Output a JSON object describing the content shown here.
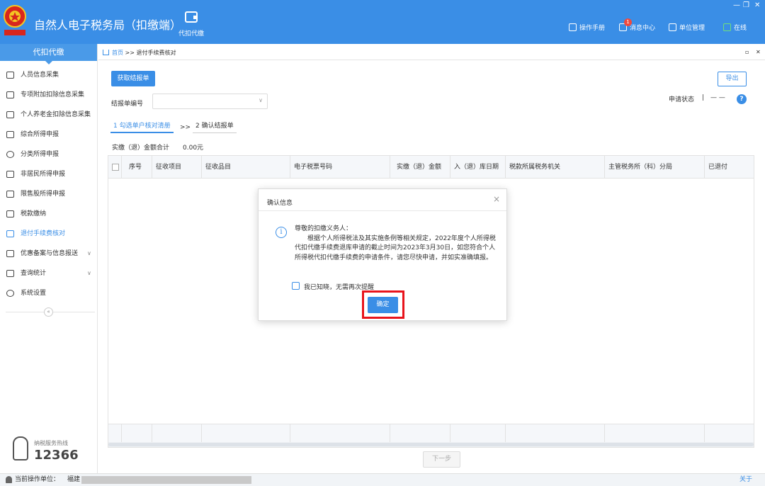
{
  "app": {
    "title": "自然人电子税务局（扣缴端）",
    "logo_text": "中国税务",
    "module_label": "代扣代缴",
    "header_links": [
      {
        "icon": "manual-icon",
        "label": "操作手册"
      },
      {
        "icon": "message-icon",
        "label": "消息中心",
        "badge": "1"
      },
      {
        "icon": "unit-icon",
        "label": "单位管理"
      },
      {
        "icon": "monitor-icon",
        "label": "在线"
      }
    ],
    "window_controls": {
      "minimize": "—",
      "restore": "❐",
      "close": "✕"
    }
  },
  "sidebar": {
    "header": "代扣代缴",
    "items": [
      {
        "label": "人员信息采集",
        "icon": "person-icon",
        "active": false
      },
      {
        "label": "专项附加扣除信息采集",
        "icon": "list-icon",
        "active": false
      },
      {
        "label": "个人养老金扣除信息采集",
        "icon": "pension-icon",
        "active": false
      },
      {
        "label": "综合所得申报",
        "icon": "layers-icon",
        "active": false
      },
      {
        "label": "分类所得申报",
        "icon": "pie-icon",
        "active": false
      },
      {
        "label": "非居民所得申报",
        "icon": "nonresident-icon",
        "active": false
      },
      {
        "label": "限售股所得申报",
        "icon": "bar-icon",
        "active": false
      },
      {
        "label": "税款缴纳",
        "icon": "folder-icon",
        "active": false
      },
      {
        "label": "退付手续费核对",
        "icon": "doc-icon",
        "active": true
      },
      {
        "label": "优惠备案与信息报送",
        "icon": "file-icon",
        "active": false,
        "expandable": true
      },
      {
        "label": "查询统计",
        "icon": "query-icon",
        "active": false,
        "expandable": true
      },
      {
        "label": "系统设置",
        "icon": "gear-icon",
        "active": false
      }
    ],
    "collapse": "«",
    "hotline_label": "纳税服务热线",
    "hotline_number": "12366"
  },
  "main": {
    "breadcrumb_home": "首页",
    "breadcrumb_sep": ">>",
    "breadcrumb_current": "退付手续费核对",
    "fetch_button": "获取结报单",
    "export_button": "导出",
    "form_label": "结报单编号",
    "select_value": "",
    "status_label": "申请状态",
    "status_sep": "|",
    "status_value": "— —",
    "help": "?",
    "steps": [
      "1 勾选单户核对清册",
      "2 确认结报单"
    ],
    "step_sep": ">>",
    "total_label": "实缴（退）金额合计",
    "total_value": "0.00元",
    "table_columns": [
      "序号",
      "征收项目",
      "征收品目",
      "电子税票号码",
      "实缴（退）金额",
      "入（退）库日期",
      "税款所属税务机关",
      "主管税务所（科）分局",
      "已退付"
    ],
    "next_button": "下一步"
  },
  "dialog": {
    "title": "确认信息",
    "close": "×",
    "icon": "i",
    "greeting": "尊敬的扣缴义务人：",
    "body": "根据个人所得税法及其实施条例等相关规定，2022年度个人所得税代扣代缴手续费退库申请的截止时间为2023年3月30日，如您符合个人所得税代扣代缴手续费的申请条件，请您尽快申请，并如实准确填报。",
    "checkbox_label": "我已知晓，无需再次提醒",
    "ok_button": "确定"
  },
  "bottom": {
    "operator_label": "当前操作单位：",
    "operator_value": "福建",
    "about": "关于"
  },
  "colors": {
    "accent": "#3a8ee6",
    "highlight": "#e8141c"
  }
}
